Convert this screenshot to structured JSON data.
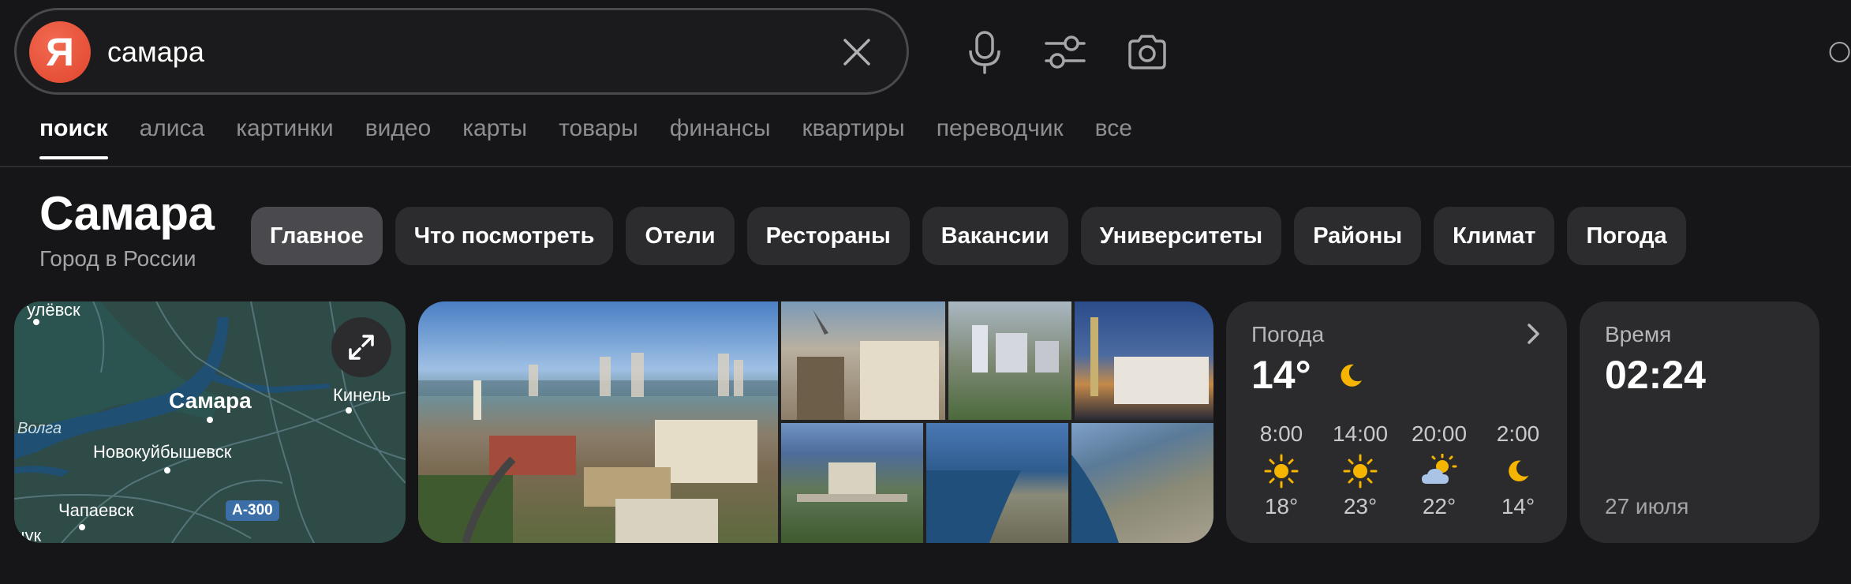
{
  "search": {
    "logo_letter": "Я",
    "query": "самара"
  },
  "toolbar_icons": [
    "microphone-icon",
    "filters-icon",
    "camera-icon",
    "notifications-icon"
  ],
  "tabs": [
    {
      "label": "поиск",
      "active": true
    },
    {
      "label": "алиса"
    },
    {
      "label": "картинки"
    },
    {
      "label": "видео"
    },
    {
      "label": "карты"
    },
    {
      "label": "товары"
    },
    {
      "label": "финансы"
    },
    {
      "label": "квартиры"
    },
    {
      "label": "переводчик"
    },
    {
      "label": "все"
    }
  ],
  "entity": {
    "title": "Самара",
    "subtitle": "Город в России"
  },
  "chips": [
    {
      "label": "Главное",
      "active": true
    },
    {
      "label": "Что посмотреть"
    },
    {
      "label": "Отели"
    },
    {
      "label": "Рестораны"
    },
    {
      "label": "Вакансии"
    },
    {
      "label": "Университеты"
    },
    {
      "label": "Районы"
    },
    {
      "label": "Климат"
    },
    {
      "label": "Погода"
    }
  ],
  "map": {
    "labels": {
      "ulyovsk": "улёвск",
      "samara": "Самара",
      "kinel": "Кинель",
      "volga": "Волга",
      "novokuibyshevsk": "Новокуйбышевск",
      "chapaevsk": "Чапаевск",
      "chuk": "чук",
      "road": "A-300"
    },
    "colors": {
      "land": "#2f4b47",
      "water": "#1f4f73",
      "roads": "#5f7f86"
    }
  },
  "weather": {
    "title": "Погода",
    "current_temp": "14°",
    "current_icon": "moon-icon",
    "forecast": [
      {
        "time": "8:00",
        "icon": "sun-icon",
        "temp": "18°"
      },
      {
        "time": "14:00",
        "icon": "sun-icon",
        "temp": "23°"
      },
      {
        "time": "20:00",
        "icon": "partly-cloudy-icon",
        "temp": "22°"
      },
      {
        "time": "2:00",
        "icon": "moon-icon",
        "temp": "14°"
      }
    ]
  },
  "time": {
    "title": "Время",
    "value": "02:24",
    "date": "27 июля"
  },
  "colors": {
    "background": "#161618",
    "card": "#2b2b2e",
    "chip": "#2c2c2f",
    "chip_active": "#4a4a4e",
    "logo": "#e0452c",
    "sun": "#f5b400",
    "muted_text": "#8d8d92"
  }
}
